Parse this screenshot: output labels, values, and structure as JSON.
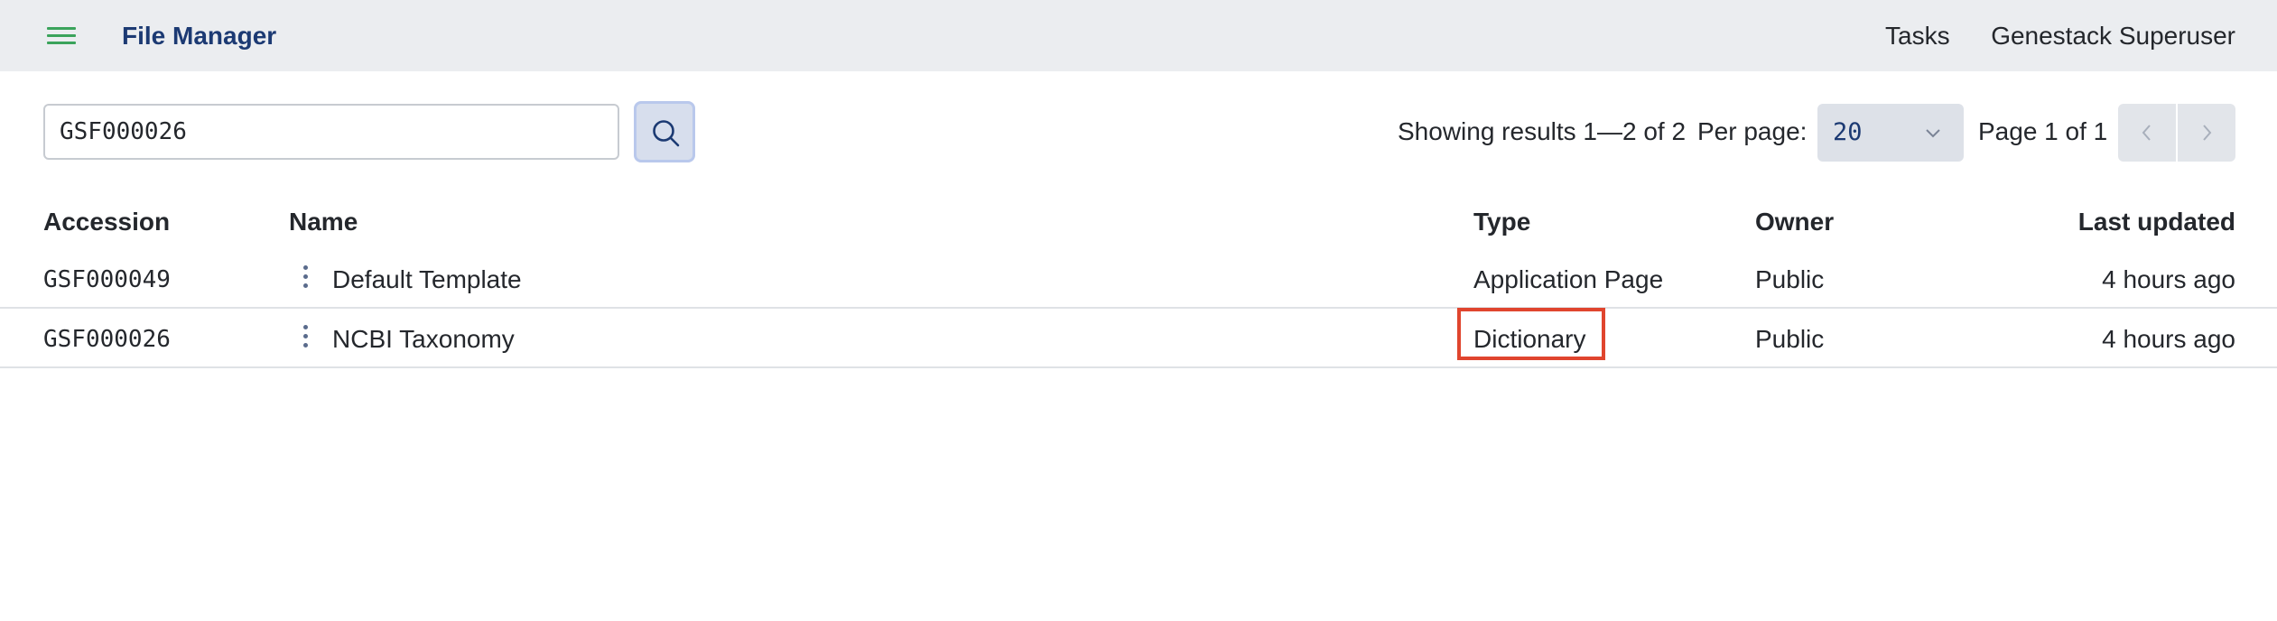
{
  "header": {
    "title": "File Manager",
    "menu_icon": "hamburger-menu-icon",
    "nav": [
      "Tasks",
      "Genestack Superuser"
    ],
    "accent_color": "#3aa35b",
    "background_color": "#ebedf0"
  },
  "search": {
    "value": "GSF000026",
    "button_icon": "search-icon"
  },
  "pagination": {
    "results_text": "Showing results 1—2 of 2",
    "per_page_label": "Per page:",
    "per_page_value": "20",
    "page_text": "Page 1 of 1",
    "prev_icon": "chevron-left-icon",
    "next_icon": "chevron-right-icon"
  },
  "table": {
    "columns": [
      "Accession",
      "Name",
      "Type",
      "Owner",
      "Last updated"
    ],
    "rows": [
      {
        "accession": "GSF000049",
        "name": "Default Template",
        "type": "Application Page",
        "owner": "Public",
        "updated": "4 hours ago"
      },
      {
        "accession": "GSF000026",
        "name": "NCBI Taxonomy",
        "type": "Dictionary",
        "owner": "Public",
        "updated": "4 hours ago"
      }
    ],
    "row_menu_icon": "kebab-menu-icon",
    "highlight_color": "#e0452e"
  }
}
